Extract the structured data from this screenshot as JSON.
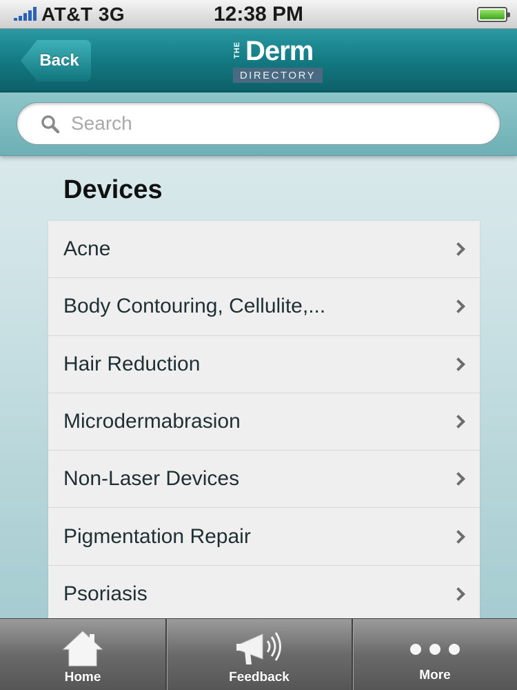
{
  "status_bar": {
    "carrier": "AT&T 3G",
    "time": "12:38 PM"
  },
  "nav": {
    "back_label": "Back",
    "logo": {
      "the": "THE",
      "derm": "Derm",
      "directory": "DIRECTORY"
    }
  },
  "search": {
    "placeholder": "Search",
    "value": ""
  },
  "section": {
    "title": "Devices"
  },
  "list": {
    "items": [
      {
        "label": "Acne"
      },
      {
        "label": "Body Contouring, Cellulite,..."
      },
      {
        "label": "Hair Reduction"
      },
      {
        "label": "Microdermabrasion"
      },
      {
        "label": "Non-Laser Devices"
      },
      {
        "label": "Pigmentation Repair"
      },
      {
        "label": "Psoriasis"
      }
    ]
  },
  "tab_bar": {
    "tabs": [
      {
        "label": "Home",
        "icon": "home-icon"
      },
      {
        "label": "Feedback",
        "icon": "megaphone-icon"
      },
      {
        "label": "More",
        "icon": "more-dots-icon"
      }
    ]
  },
  "colors": {
    "nav_teal": "#137a83",
    "search_band": "#7cbcc0",
    "battery_green": "#3aa61c",
    "signal_blue": "#2a62b8"
  }
}
